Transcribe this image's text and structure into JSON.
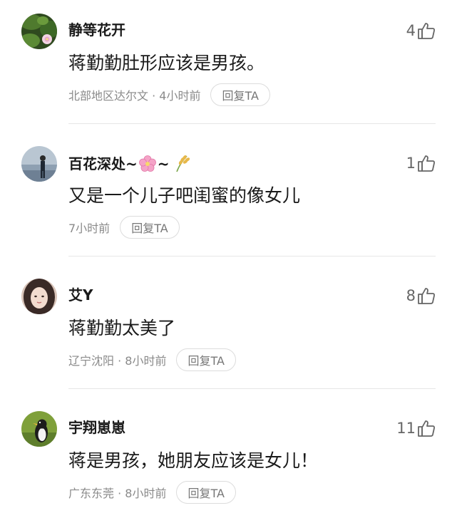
{
  "comments": [
    {
      "username": "静等花开",
      "likes": "4",
      "text": "蒋勤勤肚形应该是男孩。",
      "meta": "北部地区达尔文 · 4小时前",
      "reply_label": "回复TA"
    },
    {
      "username": "百花深处~",
      "username_mid": "~",
      "likes": "1",
      "text": "又是一个儿子吧闺蜜的像女儿",
      "meta": "7小时前",
      "reply_label": "回复TA"
    },
    {
      "username": "艾Y",
      "likes": "8",
      "text": "蒋勤勤太美了",
      "meta": "辽宁沈阳 · 8小时前",
      "reply_label": "回复TA"
    },
    {
      "username": "宇翔崽崽",
      "likes": "11",
      "text": "蒋是男孩，她朋友应该是女儿！",
      "meta": "广东东莞 · 8小时前",
      "reply_label": "回复TA"
    }
  ],
  "icons": {
    "like": "thumbs-up-icon",
    "flower_emoji": "cherry-blossom-icon",
    "rice_emoji": "rice-ear-icon"
  },
  "colors": {
    "text_primary": "#1a1a1a",
    "text_secondary": "#8a8a8a",
    "like_gray": "#666666",
    "divider": "#e6e6e6"
  }
}
